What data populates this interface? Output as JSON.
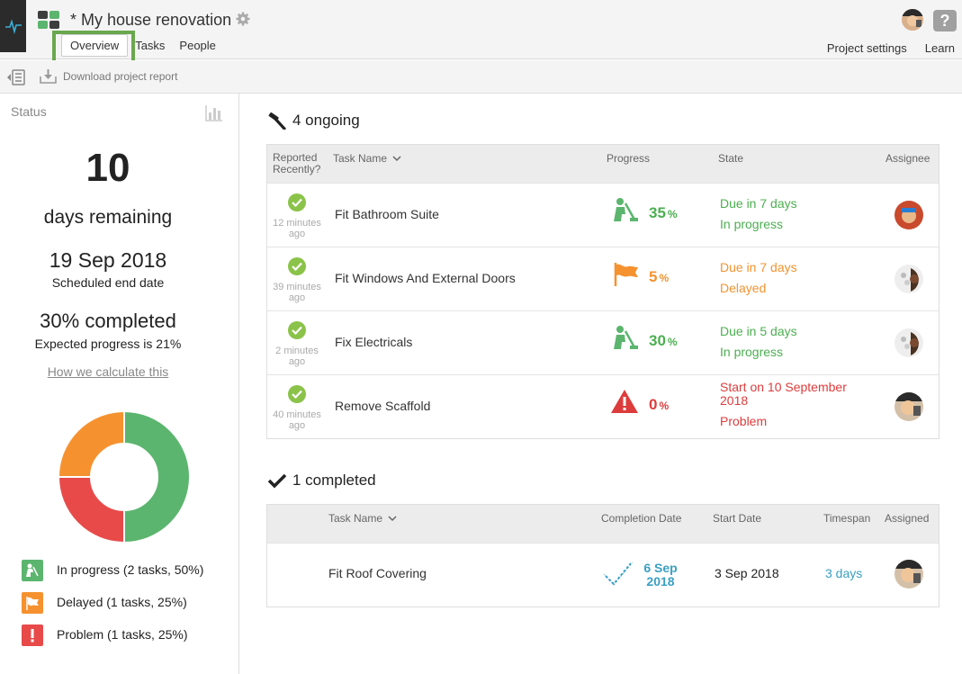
{
  "header": {
    "title": "* My house renovation",
    "tabs": [
      "Overview",
      "Tasks",
      "People"
    ],
    "right_links": [
      "Project settings",
      "Learn"
    ],
    "help_glyph": "?"
  },
  "toolbar": {
    "download_label": "Download project report"
  },
  "sidebar": {
    "status_label": "Status",
    "days_remaining_value": "10",
    "days_remaining_label": "days remaining",
    "end_date": "19 Sep 2018",
    "end_date_label": "Scheduled end date",
    "completed_text": "30% completed",
    "expected_text": "Expected progress is 21%",
    "how_link": "How we calculate this",
    "donut": [
      {
        "label": "In progress",
        "value": 50,
        "color": "#5bb56e"
      },
      {
        "label": "Problem",
        "value": 25,
        "color": "#e84a4a"
      },
      {
        "label": "Delayed",
        "value": 25,
        "color": "#f5922f"
      }
    ],
    "legend": [
      {
        "text": "In progress (2 tasks, 50%)",
        "color": "#5bb56e",
        "icon": "worker-icon"
      },
      {
        "text": "Delayed (1 tasks, 25%)",
        "color": "#f5922f",
        "icon": "flag-icon"
      },
      {
        "text": "Problem (1 tasks, 25%)",
        "color": "#e84a4a",
        "icon": "exclamation-icon"
      }
    ]
  },
  "ongoing": {
    "title": "4 ongoing",
    "headers": {
      "reported_line1": "Reported",
      "reported_line2": "Recently?",
      "task_name": "Task Name",
      "progress": "Progress",
      "state": "State",
      "assignee": "Assignee"
    },
    "rows": [
      {
        "ago1": "12 minutes",
        "ago2": "ago",
        "task": "Fit Bathroom Suite",
        "icon": "worker-icon",
        "pct": "35",
        "unit": "%",
        "state1": "Due in 7 days",
        "state2": "In progress",
        "color": "green"
      },
      {
        "ago1": "39 minutes",
        "ago2": "ago",
        "task": "Fit Windows And External Doors",
        "icon": "flag-icon",
        "pct": "5",
        "unit": "%",
        "state1": "Due in 7 days",
        "state2": "Delayed",
        "color": "orange"
      },
      {
        "ago1": "2 minutes",
        "ago2": "ago",
        "task": "Fix Electricals",
        "icon": "worker-icon",
        "pct": "30",
        "unit": "%",
        "state1": "Due in 5 days",
        "state2": "In progress",
        "color": "green"
      },
      {
        "ago1": "40 minutes",
        "ago2": "ago",
        "task": "Remove Scaffold",
        "icon": "warning-icon",
        "pct": "0",
        "unit": "%",
        "state1": "Start on 10 September 2018",
        "state2": "Problem",
        "color": "red"
      }
    ]
  },
  "completed": {
    "title": "1 completed",
    "headers": {
      "task_name": "Task Name",
      "completion_date": "Completion Date",
      "start_date": "Start Date",
      "timespan": "Timespan",
      "assigned": "Assigned"
    },
    "rows": [
      {
        "task": "Fit Roof Covering",
        "completion1": "6 Sep",
        "completion2": "2018",
        "start": "3 Sep 2018",
        "timespan": "3 days"
      }
    ]
  }
}
